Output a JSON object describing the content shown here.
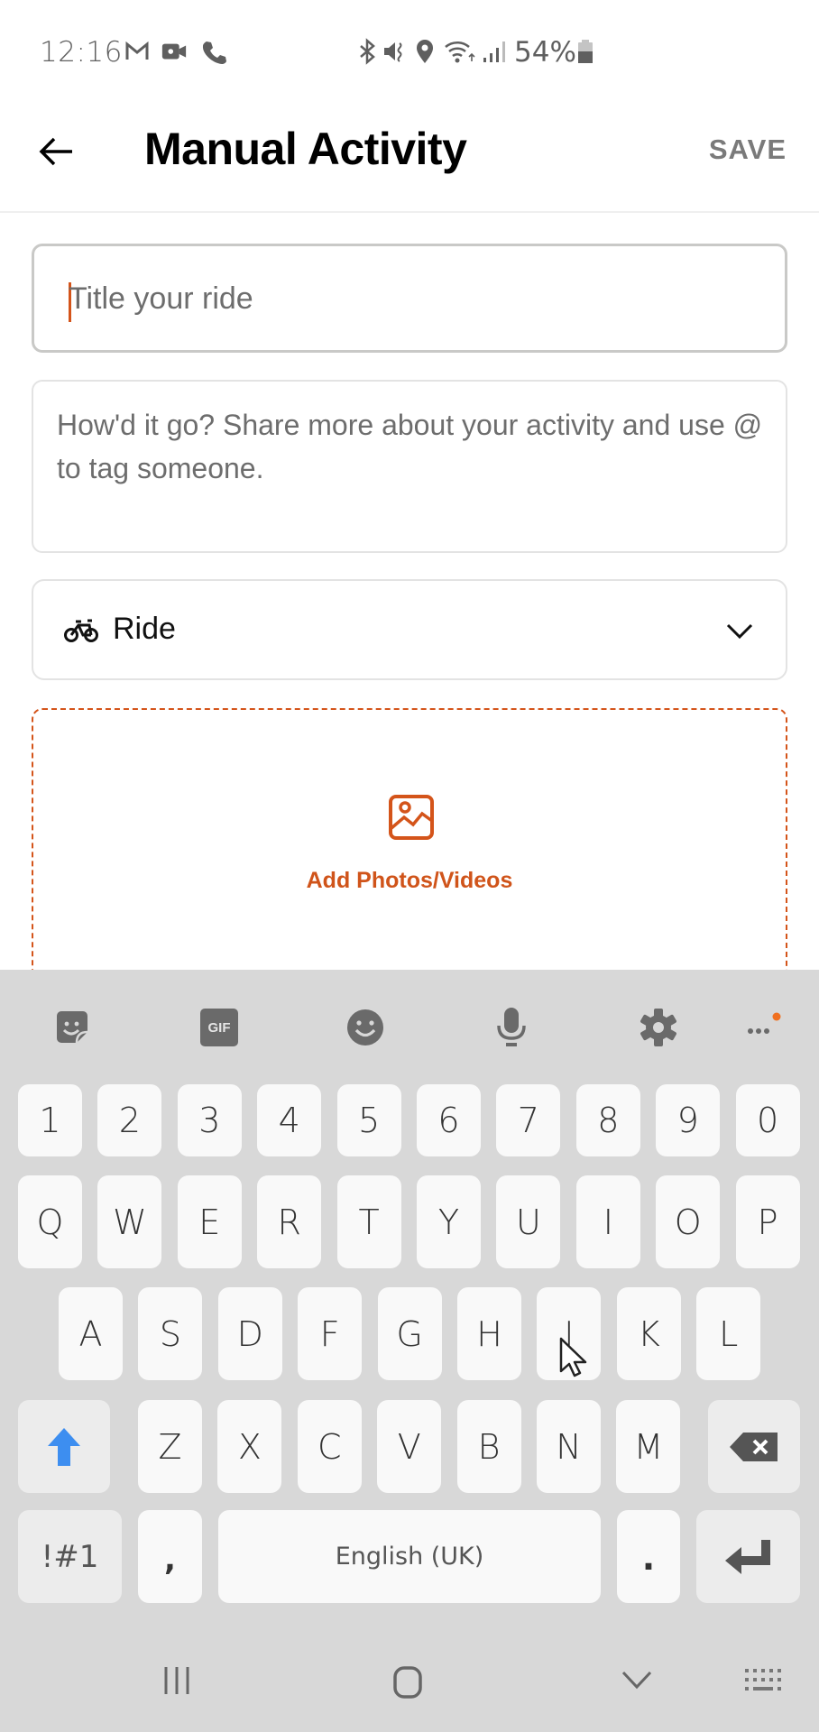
{
  "status_bar": {
    "time": "12:16",
    "left_icons": [
      "gmail-icon",
      "video-call-icon",
      "phone-call-icon"
    ],
    "right_icons": [
      "bluetooth-icon",
      "vibrate-mute-icon",
      "location-icon",
      "wifi-icon",
      "signal-icon"
    ],
    "battery_percent": "54%"
  },
  "header": {
    "back_icon": "arrow-left-icon",
    "title": "Manual Activity",
    "save_label": "SAVE"
  },
  "form": {
    "title_field": {
      "value": "",
      "placeholder": "Title your ride"
    },
    "description_field": {
      "value": "",
      "placeholder": "How'd it go? Share more about your activity and use @ to tag someone."
    },
    "sport_select": {
      "icon": "bike-icon",
      "selected": "Ride",
      "chevron": "chevron-down-icon"
    },
    "media": {
      "icon": "image-icon",
      "label": "Add Photos/Videos"
    }
  },
  "colors": {
    "accent": "#d4541a",
    "keyboard_bg": "#d8d8d8",
    "shift_active": "#3d8ef0"
  },
  "keyboard": {
    "toolbar": [
      "sticker-icon",
      "gif-icon",
      "emoji-icon",
      "microphone-icon",
      "settings-icon",
      "more-icon"
    ],
    "gif_label": "GIF",
    "rows": {
      "numbers": [
        "1",
        "2",
        "3",
        "4",
        "5",
        "6",
        "7",
        "8",
        "9",
        "0"
      ],
      "top": [
        "Q",
        "W",
        "E",
        "R",
        "T",
        "Y",
        "U",
        "I",
        "O",
        "P"
      ],
      "middle": [
        "A",
        "S",
        "D",
        "F",
        "G",
        "H",
        "J",
        "K",
        "L"
      ],
      "bottom": [
        "Z",
        "X",
        "C",
        "V",
        "B",
        "N",
        "M"
      ]
    },
    "symbols_label": "!#1",
    "comma_label": ",",
    "space_label": "English (UK)",
    "period_label": "."
  },
  "nav_bar": [
    "recents-icon",
    "home-icon",
    "back-chevron-icon",
    "keyboard-switch-icon"
  ]
}
